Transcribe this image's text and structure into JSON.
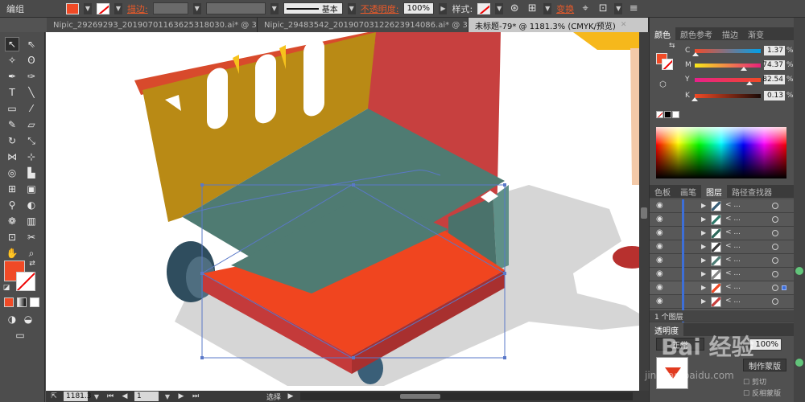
{
  "app": {
    "menu_label": "编组"
  },
  "control_bar": {
    "stroke_label": "描边",
    "stroke_colon": ":",
    "style_line_label": "基本",
    "opacity_label": "不透明度",
    "opacity_colon": ":",
    "opacity_value": "100%",
    "style_label": "样式",
    "style_colon": ":",
    "transform_label": "变换",
    "fill_color": "#f04a26"
  },
  "tabs": [
    {
      "label": "Nipic_29269293_20190701163625318030.ai* @ 33...",
      "active": false
    },
    {
      "label": "Nipic_29483542_20190703122623914086.ai* @ 33...",
      "active": false
    },
    {
      "label": "未标题-79* @ 1181.3% (CMYK/预览)",
      "active": true
    }
  ],
  "status_bar": {
    "zoom": "1181.3",
    "page": "1",
    "tool_name": "选择"
  },
  "color_panel": {
    "tabs": [
      "颜色",
      "颜色参考",
      "描边",
      "渐变"
    ],
    "sliders": [
      {
        "letter": "C",
        "value": "1.37",
        "unit": "%",
        "fraction": 0.0137,
        "gradient": "linear-gradient(to right,#f24a2a,#00a0e9)"
      },
      {
        "letter": "M",
        "value": "74.37",
        "unit": "%",
        "fraction": 0.7437,
        "gradient": "linear-gradient(to right,#f8e81a,#e8207a)"
      },
      {
        "letter": "Y",
        "value": "82.54",
        "unit": "%",
        "fraction": 0.8254,
        "gradient": "linear-gradient(to right,#e8208a,#f04a26)"
      },
      {
        "letter": "K",
        "value": "0.13",
        "unit": "%",
        "fraction": 0.0013,
        "gradient": "linear-gradient(to right,#f04a26,#1a0a06)"
      }
    ]
  },
  "layers_panel": {
    "tabs": [
      "色板",
      "画笔",
      "图层",
      "路径查找器"
    ],
    "footer_label": "1 个图层",
    "rows": [
      {
        "thumb_color": "#3a5f78"
      },
      {
        "thumb_color": "#2e7a6a"
      },
      {
        "thumb_color": "#2f6a5c"
      },
      {
        "thumb_color": "#3a3a3a"
      },
      {
        "thumb_color": "#4f7f77"
      },
      {
        "thumb_color": "#888888"
      },
      {
        "thumb_color": "#f04a26"
      },
      {
        "thumb_color": "#c7403f"
      },
      {
        "thumb_color": "#888888"
      }
    ]
  },
  "transparency_panel": {
    "title": "透明度",
    "blend_mode": "正常",
    "opacity": "100%",
    "make_mask_label": "制作蒙版",
    "clip_label": "剪切",
    "invert_label": "反相蒙版"
  },
  "watermark": {
    "text": "Bai 经验",
    "sub": "jingyan.baidu.com"
  }
}
